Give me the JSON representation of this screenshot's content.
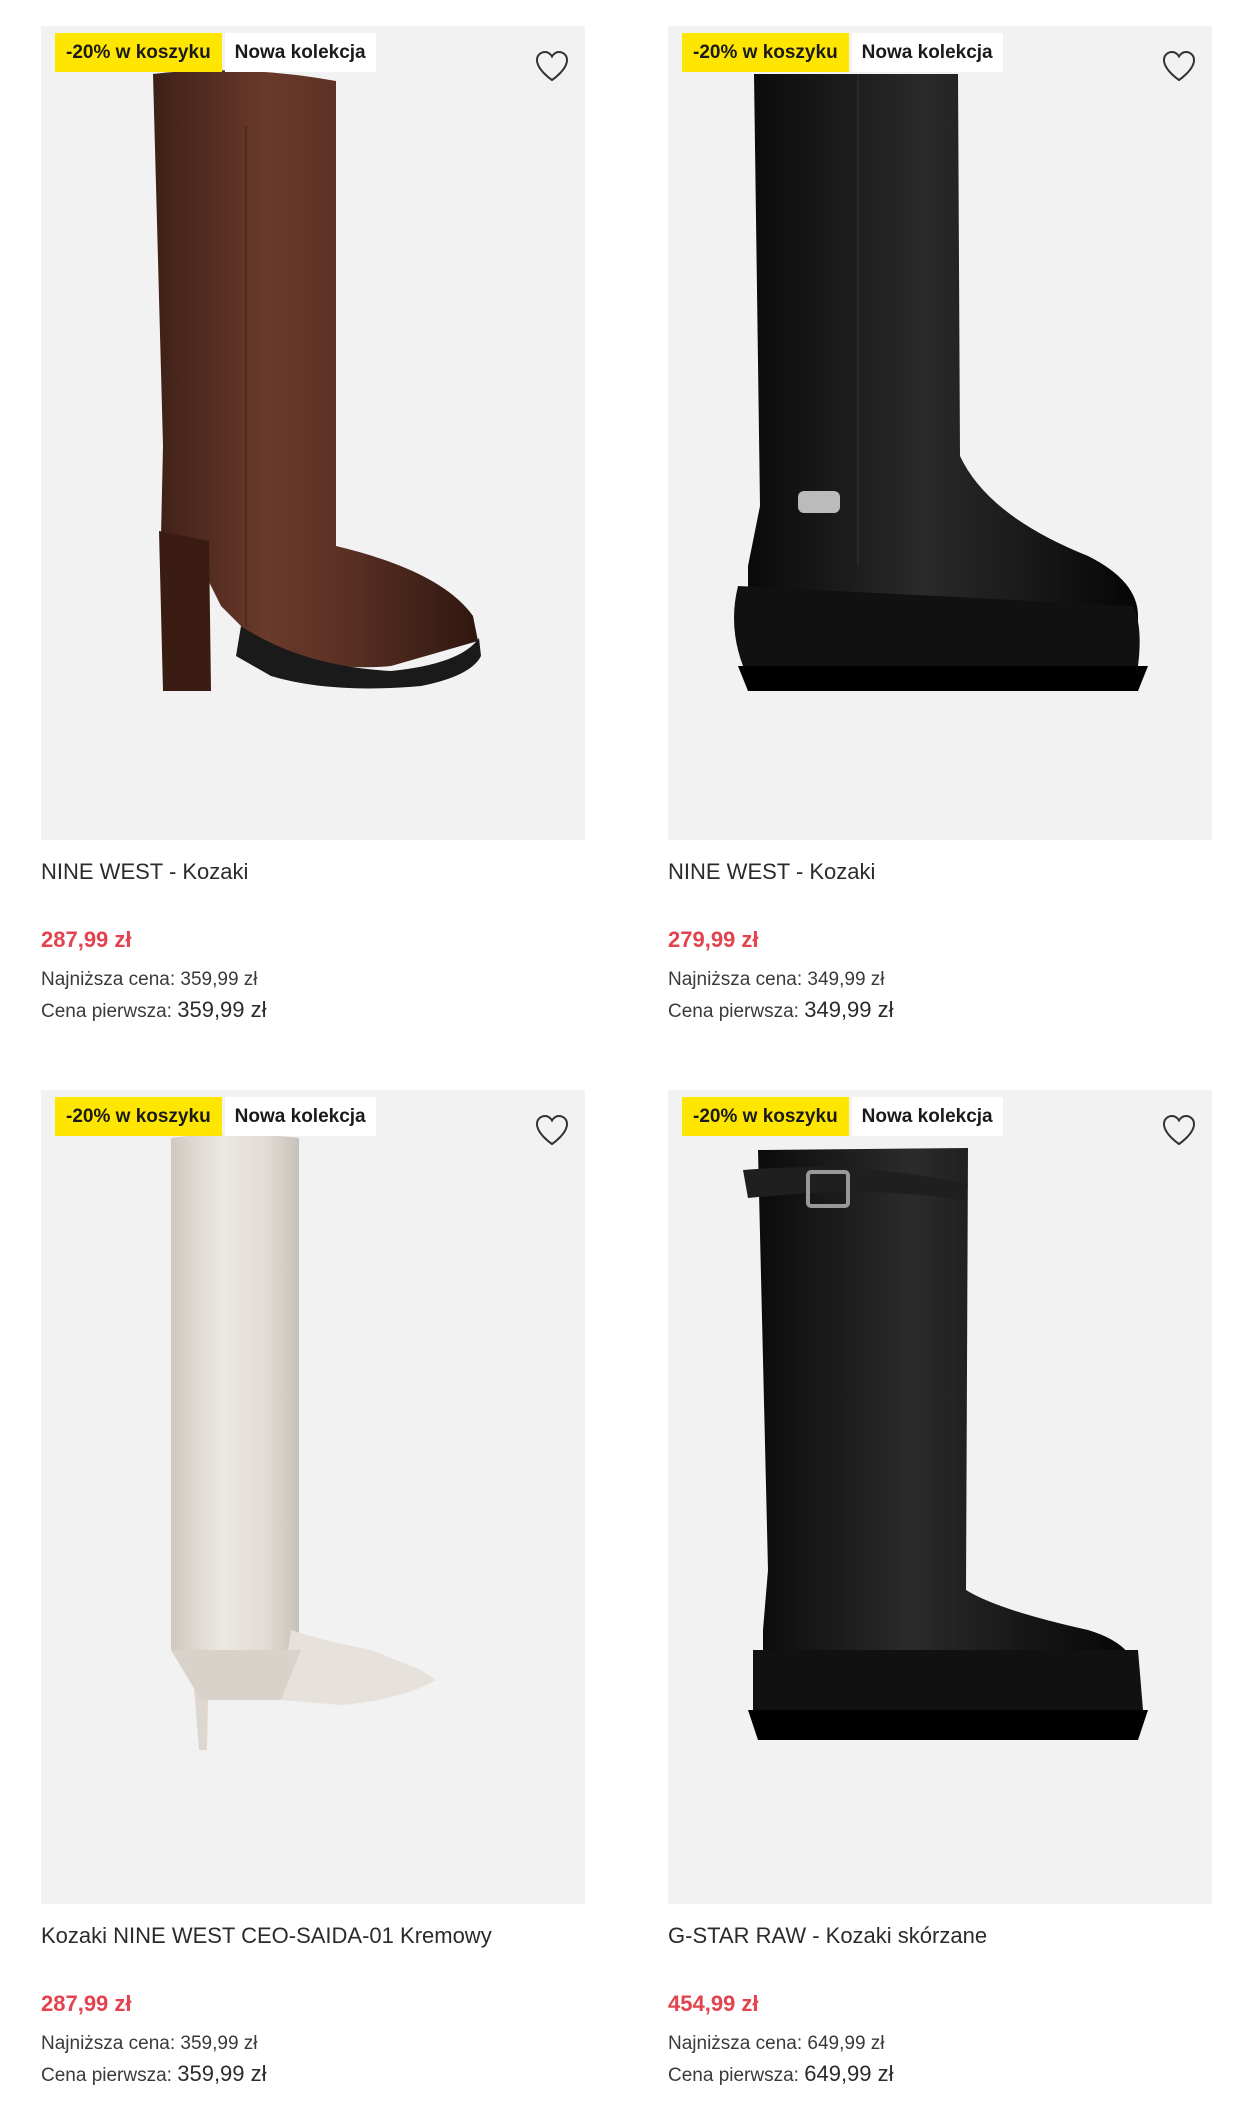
{
  "products": [
    {
      "badge_discount": "-20% w koszyku",
      "badge_new": "Nowa kolekcja",
      "title": "NINE WEST - Kozaki",
      "price": "287,99 zł",
      "lowest_label": "Najniższa cena:",
      "lowest_value": "359,99 zł",
      "first_label": "Cena pierwsza:",
      "first_value": "359,99 zł",
      "image_icon": "brown-heeled-knee-boot"
    },
    {
      "badge_discount": "-20% w koszyku",
      "badge_new": "Nowa kolekcja",
      "title": "NINE WEST - Kozaki",
      "price": "279,99 zł",
      "lowest_label": "Najniższa cena:",
      "lowest_value": "349,99 zł",
      "first_label": "Cena pierwsza:",
      "first_value": "349,99 zł",
      "image_icon": "black-platform-knee-boot-with-buckle"
    },
    {
      "badge_discount": "-20% w koszyku",
      "badge_new": "Nowa kolekcja",
      "title": "Kozaki NINE WEST CEO-SAIDA-01 Kremowy",
      "price": "287,99 zł",
      "lowest_label": "Najniższa cena:",
      "lowest_value": "359,99 zł",
      "first_label": "Cena pierwsza:",
      "first_value": "359,99 zł",
      "image_icon": "cream-stiletto-fold-over-boot"
    },
    {
      "badge_discount": "-20% w koszyku",
      "badge_new": "Nowa kolekcja",
      "title": "G-STAR RAW - Kozaki skórzane",
      "price": "454,99 zł",
      "lowest_label": "Najniższa cena:",
      "lowest_value": "649,99 zł",
      "first_label": "Cena pierwsza:",
      "first_value": "649,99 zł",
      "image_icon": "black-leather-knee-boot-with-strap"
    }
  ],
  "colors": {
    "discount_badge": "#ffe600",
    "price_red": "#e3434f",
    "image_bg": "#f2f2f2"
  }
}
